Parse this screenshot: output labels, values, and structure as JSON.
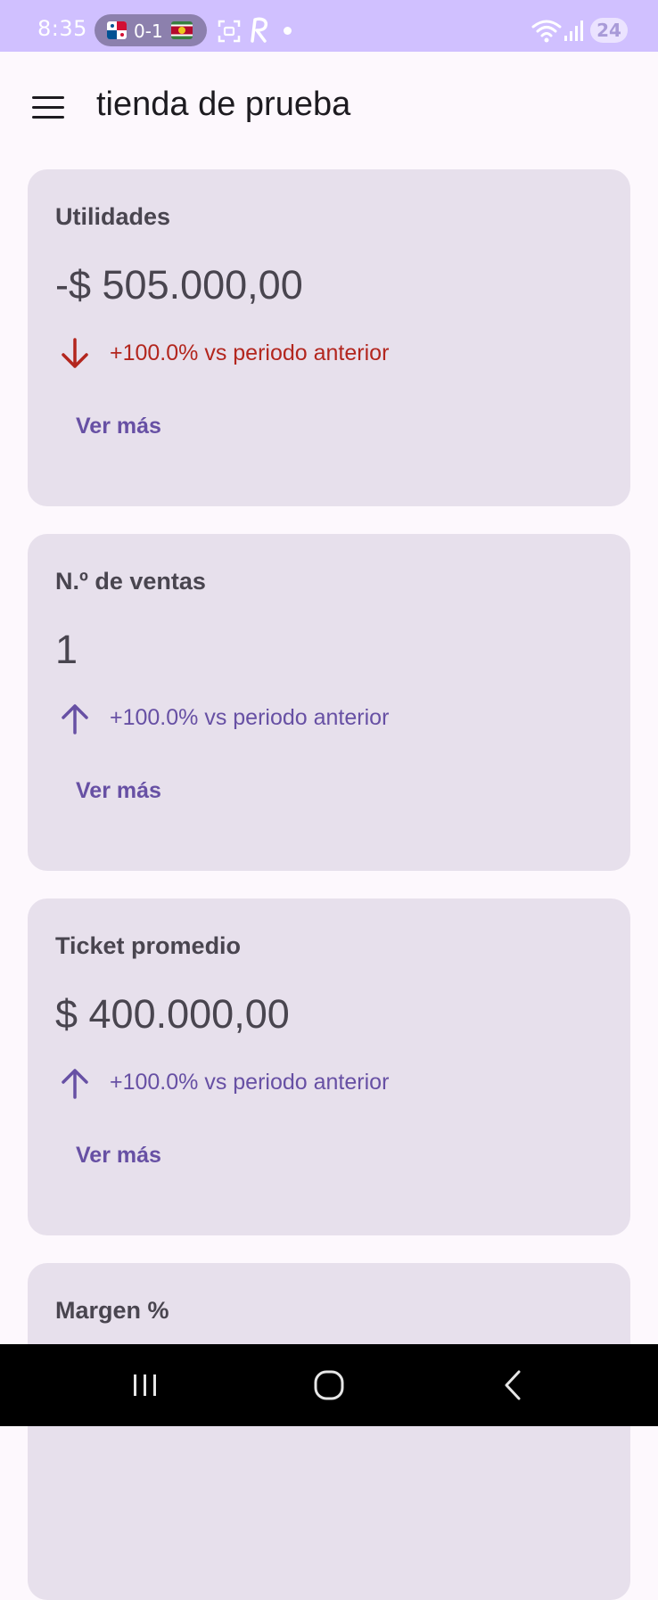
{
  "status_bar": {
    "time": "8:35",
    "score": "0-1",
    "battery": "24",
    "background_color": "#d0c0ff"
  },
  "app_bar": {
    "title": "tienda de prueba",
    "menu_icon": "menu-icon"
  },
  "cards": [
    {
      "title": "Utilidades",
      "value": "-$ 505.000,00",
      "trend_direction": "down",
      "trend_icon": "arrow-down-icon",
      "trend_text": "+100.0% vs periodo anterior",
      "trend_color": "#b3261e",
      "action_label": "Ver más"
    },
    {
      "title": "N.º de ventas",
      "value": "1",
      "trend_direction": "up",
      "trend_icon": "arrow-up-icon",
      "trend_text": "+100.0% vs periodo anterior",
      "trend_color": "#6750a4",
      "action_label": "Ver más"
    },
    {
      "title": "Ticket promedio",
      "value": "$ 400.000,00",
      "trend_direction": "up",
      "trend_icon": "arrow-up-icon",
      "trend_text": "+100.0% vs periodo anterior",
      "trend_color": "#6750a4",
      "action_label": "Ver más"
    },
    {
      "title": "Margen %"
    }
  ],
  "nav_bar": {
    "recents_icon": "recent-apps-icon",
    "home_icon": "home-icon",
    "back_icon": "back-icon"
  },
  "colors": {
    "page_background": "#fdf8fd",
    "card_background": "#e7e0ec",
    "primary": "#6750a4",
    "error": "#b3261e"
  }
}
